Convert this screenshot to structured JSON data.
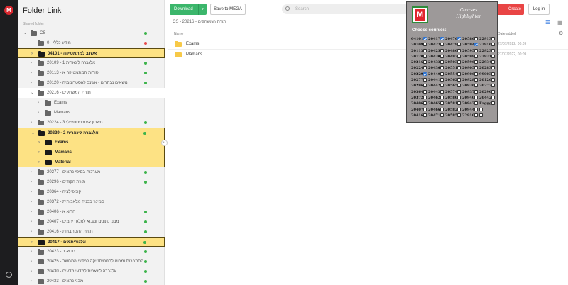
{
  "rail": {
    "logo": "M"
  },
  "sidebar": {
    "title": "Folder Link",
    "caption": "Shared folder",
    "rows": [
      {
        "label": "CS",
        "indent": 0,
        "chev": "v",
        "dot": "green",
        "hl": "",
        "bold": false
      },
      {
        "label": "מידע כללי - 0",
        "indent": 1,
        "chev": "",
        "dot": "red",
        "hl": "",
        "bold": false
      },
      {
        "label": "אשנב למתמטיקה - 04101",
        "indent": 1,
        "chev": ">",
        "dot": "",
        "hl": "single",
        "bold": true,
        "dark": true
      },
      {
        "label": "אלגברה לינארית 1 - 20109",
        "indent": 1,
        "chev": ">",
        "dot": "green",
        "hl": "",
        "bold": false
      },
      {
        "label": "יסודות המתמטיקה א - 20113",
        "indent": 1,
        "chev": ">",
        "dot": "green",
        "hl": "",
        "bold": false
      },
      {
        "label": "נושאים נבחרים - אשנב לאסטרונומיה - 20120",
        "indent": 1,
        "chev": ">",
        "dot": "green",
        "hl": "",
        "bold": false
      },
      {
        "label": "תורת המשחקים - 20216",
        "indent": 1,
        "chev": "v",
        "dot": "",
        "hl": "",
        "bold": false,
        "open": true
      },
      {
        "label": "Exams",
        "indent": 2,
        "chev": ">",
        "dot": "",
        "hl": "",
        "bold": false
      },
      {
        "label": "Mamans",
        "indent": 2,
        "chev": ">",
        "dot": "",
        "hl": "",
        "bold": false
      },
      {
        "label": "חשבון אינפיניטסימלי 3 - 20224",
        "indent": 1,
        "chev": ">",
        "dot": "green",
        "hl": "",
        "bold": false
      },
      {
        "label": "אלגברה לינארית 2 - 20229",
        "indent": 1,
        "chev": "v",
        "dot": "green",
        "hl": "top",
        "bold": true,
        "dark": true
      },
      {
        "label": "Exams",
        "indent": 2,
        "chev": ">",
        "dot": "",
        "hl": "mid",
        "bold": true,
        "dark": true
      },
      {
        "label": "Mamans",
        "indent": 2,
        "chev": ">",
        "dot": "",
        "hl": "mid",
        "bold": true,
        "dark": true
      },
      {
        "label": "Material",
        "indent": 2,
        "chev": ">",
        "dot": "",
        "hl": "bot",
        "bold": true,
        "dark": true
      },
      {
        "label": "מערכות בסיסי נתונים - 20277",
        "indent": 1,
        "chev": ">",
        "dot": "green",
        "hl": "",
        "bold": false
      },
      {
        "label": "תורת הקודים - 20296",
        "indent": 1,
        "chev": ">",
        "dot": "green",
        "hl": "",
        "bold": false
      },
      {
        "label": "קומפילציה - 20364",
        "indent": 1,
        "chev": ">",
        "dot": "",
        "hl": "",
        "bold": false
      },
      {
        "label": "סמינר בבניה מלאכותית - 20372",
        "indent": 1,
        "chev": ">",
        "dot": "",
        "hl": "",
        "bold": false
      },
      {
        "label": "חדוא א - 20406",
        "indent": 1,
        "chev": ">",
        "dot": "green",
        "hl": "",
        "bold": false
      },
      {
        "label": "מבני נתונים ומבוא לאלגוריתמים - 20407",
        "indent": 1,
        "chev": ">",
        "dot": "green",
        "hl": "",
        "bold": false
      },
      {
        "label": "תורת ההסתברות - 20416",
        "indent": 1,
        "chev": ">",
        "dot": "green",
        "hl": "",
        "bold": false
      },
      {
        "label": "אלגוריתמים - 20417",
        "indent": 1,
        "chev": ">",
        "dot": "green",
        "hl": "single",
        "bold": true,
        "dark": true
      },
      {
        "label": "חדוא ב - 20423",
        "indent": 1,
        "chev": ">",
        "dot": "green",
        "hl": "",
        "bold": false
      },
      {
        "label": "הסתברות ומבוא לסטטיסטיקה למדעי המחשב - 20425",
        "indent": 1,
        "chev": ">",
        "dot": "green",
        "hl": "",
        "bold": false
      },
      {
        "label": "אלגברה לינארית למדעי מדעים - 20430",
        "indent": 1,
        "chev": ">",
        "dot": "green",
        "hl": "",
        "bold": false
      },
      {
        "label": "מבני נתונים - 20433",
        "indent": 1,
        "chev": ">",
        "dot": "green",
        "hl": "",
        "bold": false
      }
    ]
  },
  "toolbar": {
    "download_label": "Download",
    "save_label": "Save to MEGA",
    "search_placeholder": "Search",
    "create_label": "Create account",
    "login_label": "Log in"
  },
  "breadcrumb": "CS  ›  20216 - תורת המשחקים",
  "table": {
    "header_name": "Name",
    "header_added": "Date added",
    "rows": [
      {
        "name": "Exams",
        "date": "27/07/2022, 00:09"
      },
      {
        "name": "Mamans",
        "date": "27/07/2022, 00:09"
      }
    ]
  },
  "popup": {
    "logo": "M",
    "title_line1": "Courses",
    "title_line2": "Highlighter",
    "subtitle": "Choose courses:",
    "columns": [
      [
        [
          "04101",
          true
        ],
        [
          "20109",
          false
        ],
        [
          "20113",
          false
        ],
        [
          "20120",
          false
        ],
        [
          "20216",
          false
        ],
        [
          "20224",
          false
        ],
        [
          "20229",
          true
        ],
        [
          "20277",
          false
        ],
        [
          "20296",
          false
        ],
        [
          "20364",
          false
        ],
        [
          "20372",
          false
        ],
        [
          "20406",
          false
        ],
        [
          "20407",
          false
        ],
        [
          "20416",
          false
        ]
      ],
      [
        [
          "20417",
          true
        ],
        [
          "20423",
          false
        ],
        [
          "20425",
          false
        ],
        [
          "20430",
          false
        ],
        [
          "20433",
          false
        ],
        [
          "20436",
          false
        ],
        [
          "20440",
          false
        ],
        [
          "20441",
          false
        ],
        [
          "20442",
          false
        ],
        [
          "20443",
          false
        ],
        [
          "20462",
          false
        ],
        [
          "20465",
          false
        ],
        [
          "20466",
          false
        ],
        [
          "20471",
          false
        ]
      ],
      [
        [
          "20476",
          true
        ],
        [
          "20478",
          false
        ],
        [
          "20480",
          false
        ],
        [
          "20492",
          false
        ],
        [
          "20503",
          false
        ],
        [
          "20551",
          false
        ],
        [
          "20554",
          false
        ],
        [
          "20562",
          false
        ],
        [
          "20565",
          false
        ],
        [
          "20574",
          false
        ],
        [
          "20580",
          false
        ],
        [
          "20581",
          false
        ],
        [
          "20582",
          false
        ],
        [
          "20585",
          false
        ]
      ],
      [
        [
          "20586",
          false
        ],
        [
          "20594",
          true
        ],
        [
          "20595",
          false
        ],
        [
          "20598",
          false
        ],
        [
          "20596",
          false
        ],
        [
          "20905",
          false
        ],
        [
          "20906",
          false
        ],
        [
          "20928",
          false
        ],
        [
          "20936",
          false
        ],
        [
          "20937",
          false
        ],
        [
          "20940",
          false
        ],
        [
          "20942",
          false
        ],
        [
          "20944",
          false
        ],
        [
          "22910",
          false
        ]
      ],
      [
        [
          "22913",
          false
        ],
        [
          "22916",
          false
        ],
        [
          "22923",
          false
        ],
        [
          "22931",
          false
        ],
        [
          "22934",
          false
        ],
        [
          "20283",
          false
        ],
        [
          "99003",
          false
        ],
        [
          "20126",
          false
        ],
        [
          "20272",
          false
        ],
        [
          "20290",
          false
        ],
        [
          "20442",
          false
        ],
        [
          "Eaggg",
          false
        ],
        [
          "",
          false
        ],
        [
          "",
          false
        ]
      ]
    ]
  }
}
